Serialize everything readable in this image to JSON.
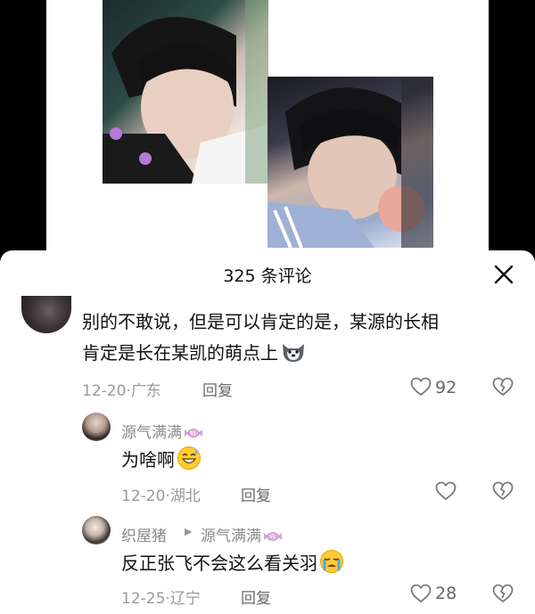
{
  "sheet": {
    "title": "325 条评论"
  },
  "comments": [
    {
      "text_line1": "别的不敢说，但是可以肯定的是，某源的长相",
      "text_line2": "肯定是长在某凯的萌点上",
      "date": "12-20",
      "location": "广东",
      "reply_label": "回复",
      "likes": "92"
    },
    {
      "user": "源气满满",
      "text": "为啥啊",
      "date": "12-20",
      "location": "湖北",
      "reply_label": "回复"
    },
    {
      "user": "织屋猪",
      "reply_to": "源气满满",
      "text": "反正张飞不会这么看关羽",
      "date": "12-25",
      "location": "辽宁",
      "reply_label": "回复",
      "likes": "28"
    }
  ],
  "separator": "·",
  "icons": {
    "close": "close-icon",
    "like": "heart-outline-icon",
    "dislike": "broken-heart-icon",
    "candy": "candy-icon",
    "husky": "husky-emoji",
    "grin": "grinning-sweat-emoji",
    "cry": "crying-emoji"
  },
  "colors": {
    "text": "#111111",
    "muted": "#8a8a8a",
    "sheet_bg": "#ffffff",
    "backdrop": "#000000"
  }
}
